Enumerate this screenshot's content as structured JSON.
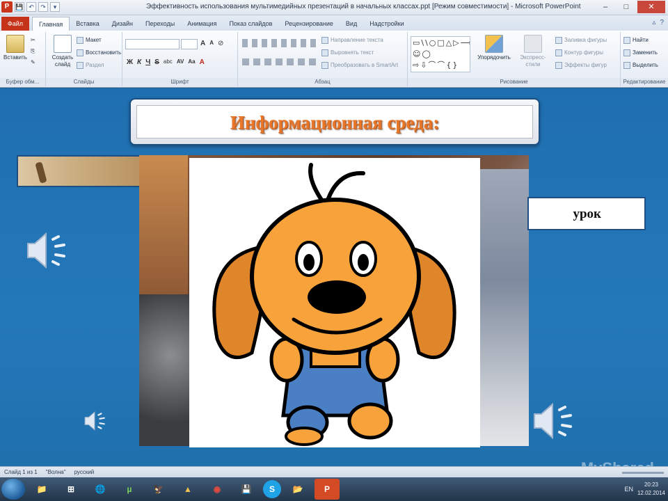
{
  "window": {
    "title": "Эффективность использования мультимедийных презентаций в начальных классах.ppt [Режим совместимости] - Microsoft PowerPoint",
    "app_letter": "P",
    "controls": {
      "minimize": "–",
      "maximize": "□",
      "close": "✕"
    }
  },
  "quick_access": {
    "save": "💾",
    "undo": "↶",
    "redo": "↷",
    "customize": "▾"
  },
  "ribbon_tabs": {
    "file": "Файл",
    "items": [
      "Главная",
      "Вставка",
      "Дизайн",
      "Переходы",
      "Анимация",
      "Показ слайдов",
      "Рецензирование",
      "Вид",
      "Надстройки"
    ],
    "right_icons": [
      "▵",
      "?"
    ]
  },
  "ribbon": {
    "clipboard": {
      "paste": "Вставить",
      "label": "Буфер обм..."
    },
    "slides": {
      "new_slide": "Создать слайд",
      "layout": "Макет",
      "reset": "Восстановить",
      "section": "Раздел",
      "label": "Слайды"
    },
    "font": {
      "grow": "A",
      "shrink": "A",
      "clear": "⊘",
      "bold": "Ж",
      "italic": "К",
      "underline": "Ч",
      "strike": "S",
      "shadow": "abc",
      "spacing": "AV",
      "case": "Aa",
      "color": "A",
      "label": "Шрифт"
    },
    "paragraph": {
      "text_direction": "Направление текста",
      "align_text": "Выровнять текст",
      "smartart": "Преобразовать в SmartArt",
      "label": "Абзац"
    },
    "drawing": {
      "shapes": "▭\\\\○□△▷⟶↗△⌐⌐☺◯ ⇨⇩⌒⌒{} ",
      "arrange": "Упорядочить",
      "quick_styles": "Экспресс-стили",
      "fill": "Заливка фигуры",
      "outline": "Контур фигуры",
      "effects": "Эффекты фигур",
      "label": "Рисование"
    },
    "editing": {
      "find": "Найти",
      "replace": "Заменить",
      "select": "Выделить",
      "label": "Редактирование"
    }
  },
  "slide": {
    "title": "Информационная среда:",
    "lesson_label": "урок"
  },
  "status": {
    "slide": "Слайд 1 из 1",
    "theme": "\"Волна\"",
    "language": "русский"
  },
  "taskbar": {
    "apps": [
      "📁",
      "⊞",
      "🌐",
      "µ",
      "🦅",
      "▲",
      "◉",
      "💾",
      "S",
      "📂",
      "P"
    ],
    "tray": {
      "lang": "EN",
      "time": "20:23",
      "date": "12.02.2014"
    }
  },
  "watermark": "MyShared",
  "colors": {
    "title_orange": "#e8772a",
    "slide_blue": "#2173b4",
    "file_tab": "#c4331a"
  }
}
